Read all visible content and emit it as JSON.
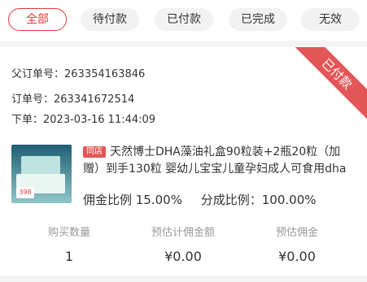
{
  "tabs": [
    {
      "label": "全部",
      "active": true
    },
    {
      "label": "待付款",
      "active": false
    },
    {
      "label": "已付款",
      "active": false
    },
    {
      "label": "已完成",
      "active": false
    },
    {
      "label": "无效",
      "active": false
    }
  ],
  "order": {
    "status_ribbon": "已付款",
    "parent_order": "父订单号：263354163846",
    "order_no": "订单号：263341672514",
    "placed_at": "下单：2023-03-16 11:44:09"
  },
  "product": {
    "store_tag": "同店",
    "title": "天然博士DHA藻油礼盒90粒装+2瓶20粒（加赠）到手130粒 婴幼儿宝宝儿童孕妇成人可食用dha",
    "commission_ratio": "佣金比例 15.00%",
    "share_ratio": "分成比例：100.00%",
    "thumb_badge": "398"
  },
  "stats": [
    {
      "label": "购买数量",
      "value": "1"
    },
    {
      "label": "预估计佣金额",
      "value": "¥0.00"
    },
    {
      "label": "预估佣金",
      "value": "¥0.00"
    }
  ],
  "colors": {
    "accent": "#e23a3a",
    "ribbon": "#e35656",
    "muted": "#999999"
  }
}
